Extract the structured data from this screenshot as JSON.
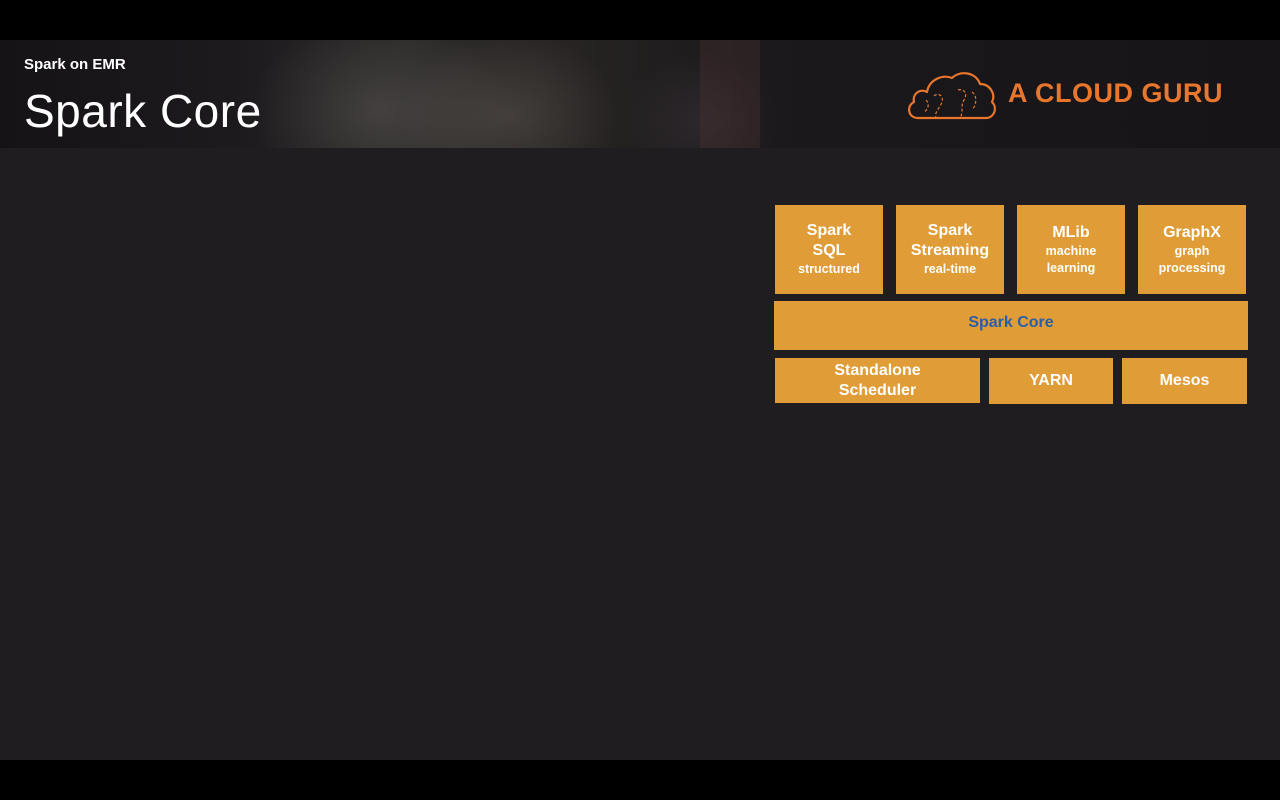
{
  "header": {
    "subtitle": "Spark on EMR",
    "title": "Spark Core",
    "brand": "A CLOUD GURU"
  },
  "colors": {
    "block_fill": "#e09c36",
    "core_label": "#2a5fa8",
    "brand": "#e8762c",
    "background": "#1f1d20"
  },
  "diagram": {
    "libraries": [
      {
        "lines": [
          "Spark",
          "SQL"
        ],
        "sub": [
          "structured"
        ]
      },
      {
        "lines": [
          "Spark",
          "Streaming"
        ],
        "sub": [
          "real-time"
        ]
      },
      {
        "lines": [
          "MLib"
        ],
        "sub": [
          "machine",
          "learning"
        ]
      },
      {
        "lines": [
          "GraphX"
        ],
        "sub": [
          "graph",
          "processing"
        ]
      }
    ],
    "core": "Spark Core",
    "schedulers": [
      {
        "lines": [
          "Standalone",
          "Scheduler"
        ]
      },
      {
        "lines": [
          "YARN"
        ]
      },
      {
        "lines": [
          "Mesos"
        ]
      }
    ]
  }
}
